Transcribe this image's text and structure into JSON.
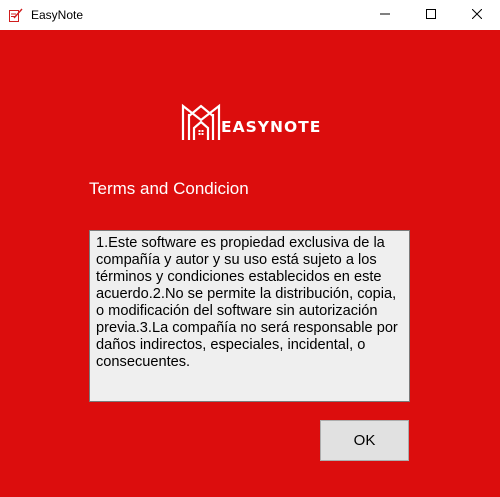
{
  "window": {
    "title": "EasyNote",
    "icons": {
      "app": "note-pen-icon",
      "minimize": "minimize-icon",
      "maximize": "maximize-icon",
      "close": "close-icon"
    }
  },
  "logo": {
    "text": "EASYNOTE",
    "icon": "house-monogram-logo"
  },
  "terms": {
    "heading": "Terms and Condicion",
    "body": "1.Este software es propiedad exclusiva de la compañía y autor y su uso está sujeto a los términos y condiciones establecidos en este acuerdo.2.No se permite la distribución, copia, o modificación del software sin autorización previa.3.La compañía no será responsable por daños indirectos, especiales, incidental, o consecuentes."
  },
  "buttons": {
    "ok_label": "OK"
  },
  "colors": {
    "background": "#dc0d0d",
    "text_light": "#ffffff",
    "box_bg": "#efefef",
    "button_bg": "#e1e1e1"
  }
}
